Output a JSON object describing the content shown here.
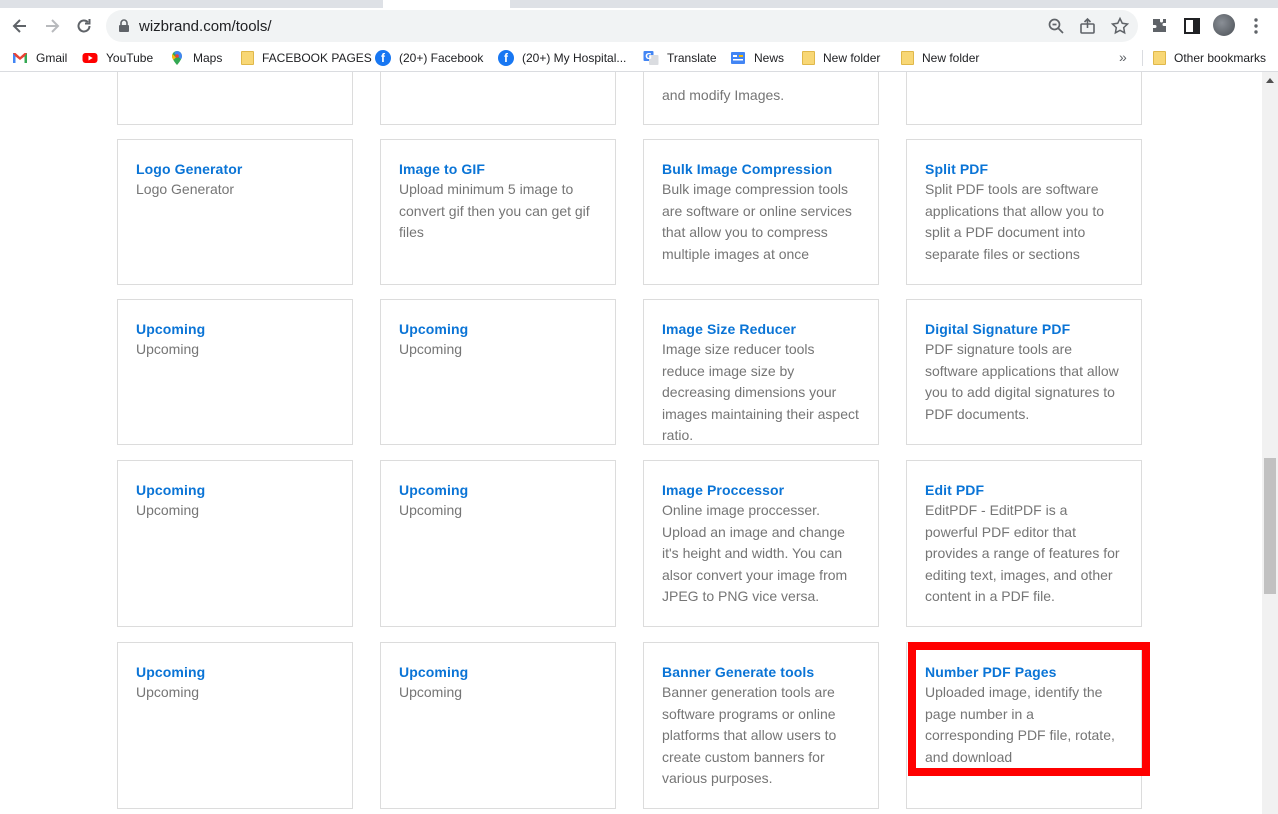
{
  "browser": {
    "url": "wizbrand.com/tools/"
  },
  "bookmarks": {
    "items": [
      {
        "label": "Gmail"
      },
      {
        "label": "YouTube"
      },
      {
        "label": "Maps"
      },
      {
        "label": "FACEBOOK PAGES"
      },
      {
        "label": "(20+) Facebook"
      },
      {
        "label": "(20+) My Hospital..."
      },
      {
        "label": "Translate"
      },
      {
        "label": "News"
      },
      {
        "label": "New folder"
      },
      {
        "label": "New folder"
      }
    ],
    "more": "»",
    "other": "Other bookmarks"
  },
  "cards": {
    "row0": [
      {
        "desc": ""
      },
      {
        "desc": ""
      },
      {
        "desc": "and modify Images."
      },
      {
        "desc": ""
      }
    ],
    "row1": [
      {
        "title": "Logo Generator",
        "desc": "Logo Generator"
      },
      {
        "title": "Image to GIF",
        "desc": "Upload minimum 5 image to convert gif then you can get gif files"
      },
      {
        "title": "Bulk Image Compression",
        "desc": "Bulk image compression tools are software or online services that allow you to compress multiple images at once"
      },
      {
        "title": "Split PDF",
        "desc": "Split PDF tools are software applications that allow you to split a PDF document into separate files or sections"
      }
    ],
    "row2": [
      {
        "title": "Upcoming",
        "desc": "Upcoming"
      },
      {
        "title": "Upcoming",
        "desc": "Upcoming"
      },
      {
        "title": "Image Size Reducer",
        "desc": "Image size reducer tools reduce image size by decreasing dimensions your images maintaining their aspect ratio."
      },
      {
        "title": "Digital Signature PDF",
        "desc": "PDF signature tools are software applications that allow you to add digital signatures to PDF documents."
      }
    ],
    "row3": [
      {
        "title": "Upcoming",
        "desc": "Upcoming"
      },
      {
        "title": "Upcoming",
        "desc": "Upcoming"
      },
      {
        "title": "Image Proccessor",
        "desc": "Online image proccesser. Upload an image and change it's height and width. You can alsor convert your image from JPEG to PNG vice versa."
      },
      {
        "title": "Edit PDF",
        "desc": "EditPDF - EditPDF is a powerful PDF editor that provides a range of features for editing text, images, and other content in a PDF file."
      }
    ],
    "row4": [
      {
        "title": "Upcoming",
        "desc": "Upcoming"
      },
      {
        "title": "Upcoming",
        "desc": "Upcoming"
      },
      {
        "title": "Banner Generate tools",
        "desc": "Banner generation tools are software programs or online platforms that allow users to create custom banners for various purposes."
      },
      {
        "title": "Number PDF Pages",
        "desc": "Uploaded image, identify the page number in a corresponding PDF file, rotate, and download"
      }
    ]
  },
  "colors": {
    "title": "#0a74d6",
    "desc": "#757575",
    "highlight": "#ff0000"
  }
}
